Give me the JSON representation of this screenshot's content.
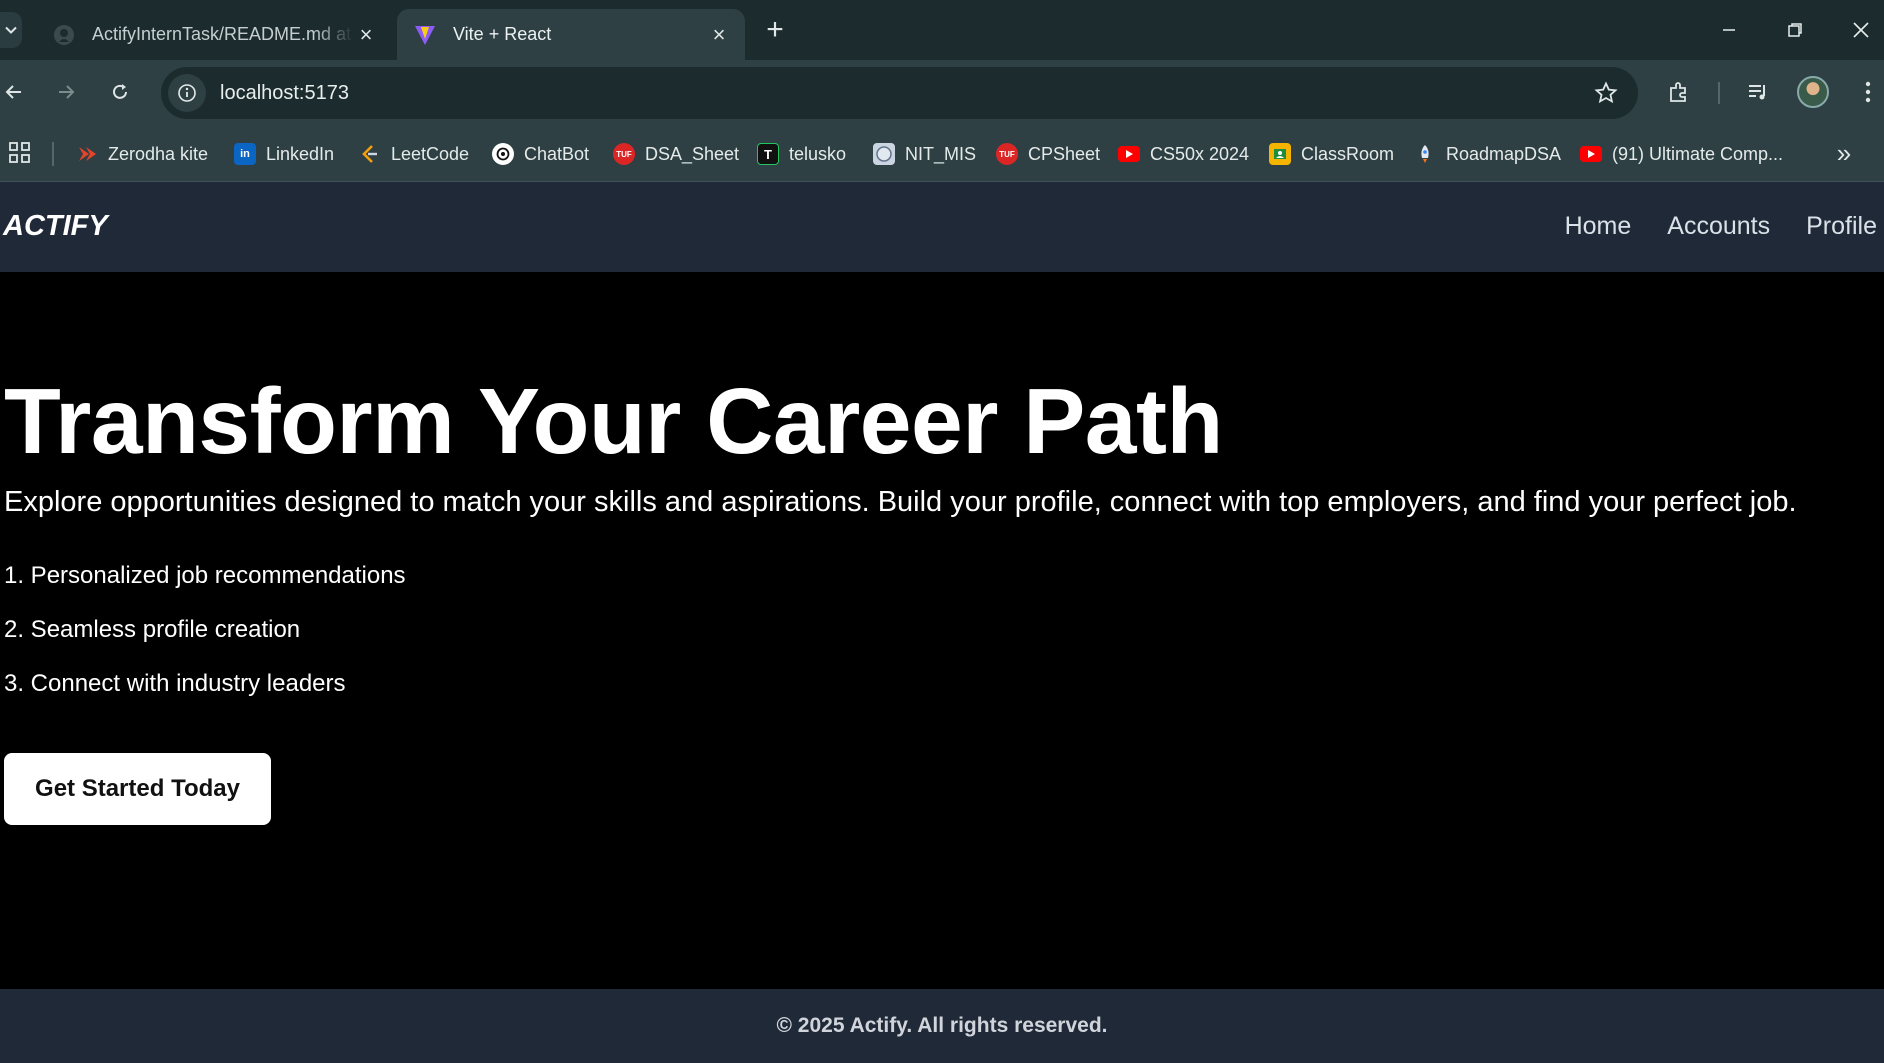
{
  "browser": {
    "tabs": [
      {
        "title": "ActifyInternTask/README.md at main",
        "active": false
      },
      {
        "title": "Vite + React",
        "active": true
      }
    ],
    "address": "localhost:5173",
    "bookmarks": [
      {
        "label": "Zerodha kite",
        "icon": "zerodha-icon",
        "color": "#e4442a"
      },
      {
        "label": "LinkedIn",
        "icon": "linkedin-icon",
        "color": "#0a66c2"
      },
      {
        "label": "LeetCode",
        "icon": "leetcode-icon",
        "color": "#f59e0b"
      },
      {
        "label": "ChatBot",
        "icon": "chatgpt-icon",
        "color": "#ffffff"
      },
      {
        "label": "DSA_Sheet",
        "icon": "tuf-icon",
        "color": "#dc2626"
      },
      {
        "label": "telusko",
        "icon": "telusko-icon",
        "color": "#111111"
      },
      {
        "label": "NIT_MIS",
        "icon": "nit-icon",
        "color": "#cbd5e1"
      },
      {
        "label": "CPSheet",
        "icon": "tuf-icon",
        "color": "#dc2626"
      },
      {
        "label": "CS50x 2024",
        "icon": "youtube-icon",
        "color": "#ff0000"
      },
      {
        "label": "ClassRoom",
        "icon": "classroom-icon",
        "color": "#f4b400"
      },
      {
        "label": "RoadmapDSA",
        "icon": "rocket-icon",
        "color": "#94a3b8"
      },
      {
        "label": "(91) Ultimate Comp...",
        "icon": "youtube-icon",
        "color": "#ff0000"
      }
    ]
  },
  "app": {
    "brand": "ACTIFY",
    "nav": [
      "Home",
      "Accounts",
      "Profile"
    ],
    "hero": {
      "title": "Transform Your Career Path",
      "subtitle": "Explore opportunities designed to match your skills and aspirations. Build your profile, connect with top employers, and find your perfect job.",
      "features": [
        "1. Personalized job recommendations",
        "2. Seamless profile creation",
        "3. Connect with industry leaders"
      ],
      "cta": "Get Started Today"
    },
    "footer": "© 2025 Actify. All rights reserved."
  }
}
